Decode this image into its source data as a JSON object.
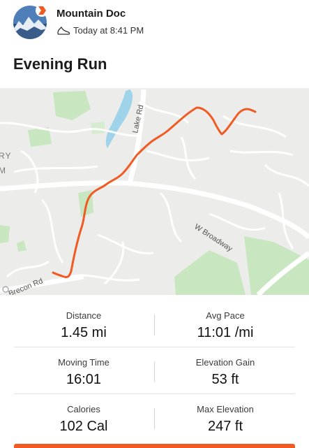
{
  "header": {
    "athlete_name": "Mountain Doc",
    "timestamp": "Today at 8:41 PM",
    "activity_icon": "running-shoe-icon",
    "avatar_icon": "mountain-avatar",
    "badge_icon": "subscriber-badge-icon"
  },
  "activity": {
    "title": "Evening Run"
  },
  "map": {
    "street_labels": {
      "lake_rd": "Lake Rd",
      "w_broadway": "W Broadway",
      "brecon_rd": "Brecon Rd",
      "partial_ry": "RY",
      "partial_m": "M"
    },
    "route_color": "#f05a23"
  },
  "stats": {
    "distance": {
      "label": "Distance",
      "value": "1.45 mi"
    },
    "avg_pace": {
      "label": "Avg Pace",
      "value": "11:01 /mi"
    },
    "moving_time": {
      "label": "Moving Time",
      "value": "16:01"
    },
    "elevation_gain": {
      "label": "Elevation Gain",
      "value": "53 ft"
    },
    "calories": {
      "label": "Calories",
      "value": "102 Cal"
    },
    "max_elevation": {
      "label": "Max Elevation",
      "value": "247 ft"
    }
  },
  "colors": {
    "accent": "#f05a23",
    "water": "#9fd3ea",
    "park": "#c8e6bf",
    "road": "#ffffff"
  }
}
